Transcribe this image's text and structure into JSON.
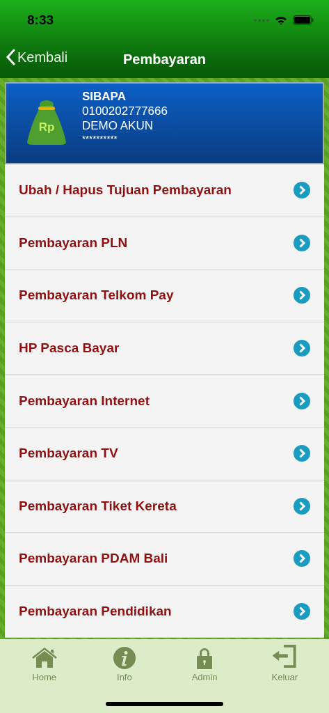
{
  "status_bar": {
    "time": "8:33"
  },
  "nav": {
    "back": "Kembali",
    "title": "Pembayaran"
  },
  "account": {
    "name": "SIBAPA",
    "number": "0100202777666",
    "holder": "DEMO AKUN",
    "secret": "**********",
    "bag_label": "Rp"
  },
  "menu": [
    {
      "label": "Ubah / Hapus Tujuan Pembayaran"
    },
    {
      "label": "Pembayaran PLN"
    },
    {
      "label": "Pembayaran Telkom Pay"
    },
    {
      "label": "HP Pasca Bayar"
    },
    {
      "label": "Pembayaran Internet"
    },
    {
      "label": "Pembayaran TV"
    },
    {
      "label": "Pembayaran Tiket Kereta"
    },
    {
      "label": "Pembayaran PDAM Bali"
    },
    {
      "label": "Pembayaran Pendidikan"
    }
  ],
  "tab_bar": [
    {
      "kind": "home",
      "label": "Home"
    },
    {
      "kind": "info",
      "label": "Info"
    },
    {
      "kind": "lock",
      "label": "Admin"
    },
    {
      "kind": "exit",
      "label": "Keluar"
    }
  ]
}
